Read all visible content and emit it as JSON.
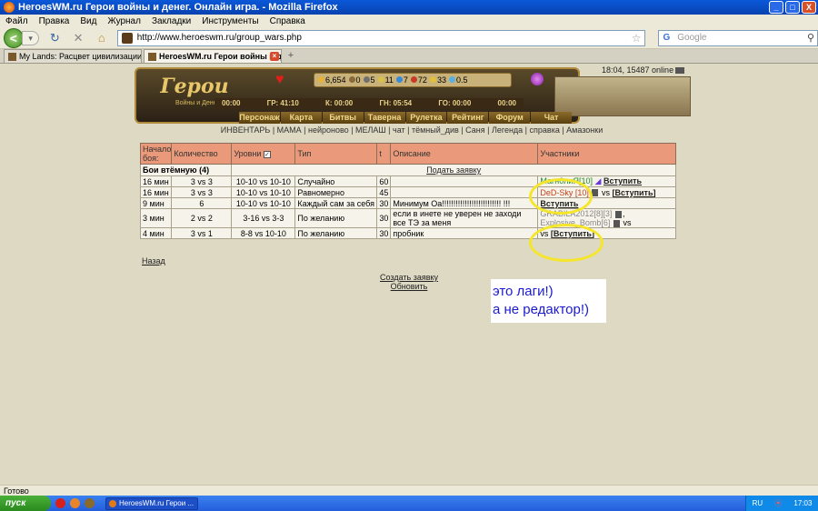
{
  "window": {
    "title": "HeroesWM.ru Герои войны и денег. Онлайн игра. - Mozilla Firefox",
    "min": "_",
    "max": "□",
    "close": "X"
  },
  "menu": [
    "Файл",
    "Правка",
    "Вид",
    "Журнал",
    "Закладки",
    "Инструменты",
    "Справка"
  ],
  "nav": {
    "back": "<",
    "forward": "▾",
    "url": "http://www.heroeswm.ru/group_wars.php",
    "search_engine": "G",
    "search_placeholder": "Google"
  },
  "tabs": [
    {
      "label": "My Lands: Расцвет цивилизации: Арх..."
    },
    {
      "label": "HeroesWM.ru Герои войны и ден..."
    }
  ],
  "game": {
    "logo": "Герои",
    "logo_sub": "Войны и Денег",
    "clock": "18:04, 15487 online",
    "resources": [
      "6,654",
      "0",
      "5",
      "11",
      "7",
      "72",
      "33",
      "0.5"
    ],
    "resource_colors": [
      "#e8b23a",
      "#8a6a3a",
      "#707070",
      "#d8c04a",
      "#3a8ad8",
      "#c83a2a",
      "#e0c03a",
      "#5ab0e0"
    ],
    "times": [
      "00:00",
      "ГР: 41:10",
      "К: 00:00",
      "ГН: 05:54",
      "ГО: 00:00",
      "00:00"
    ],
    "main_nav": [
      "Персонаж",
      "Карта",
      "Битвы",
      "Таверна",
      "Рулетка",
      "Рейтинг",
      "Форум",
      "Чат"
    ],
    "sub_nav": "ИНВЕНТАРЬ | МАМА | нейроново | МЕЛАШ | чат | тёмный_див | Саня | Легенда | справка | Амазонки"
  },
  "table": {
    "headers": [
      "Начало боя:",
      "Количество",
      "Уровни",
      "Тип",
      "t",
      "Описание",
      "Участники"
    ],
    "checkbox_mark": "✓",
    "group_title": "Бои втёмную (4)",
    "group_action": "Подать заявку",
    "rows": [
      {
        "start": "16 мин",
        "count": "3 vs 3",
        "levels": "10-10 vs 10-10",
        "type": "Случайно",
        "t": "60",
        "desc": "",
        "p_name": "Магн0лиЯ[10]",
        "p_vs": "",
        "p_name2": "",
        "join": "Вступить"
      },
      {
        "start": "16 мин",
        "count": "3 vs 3",
        "levels": "10-10 vs 10-10",
        "type": "Равномерно",
        "t": "45",
        "desc": "",
        "p_name": "DeD-Sky [10]",
        "p_vs": "vs",
        "p_name2": "",
        "join": "[Вступить]"
      },
      {
        "start": "9 мин",
        "count": "6",
        "levels": "10-10 vs 10-10",
        "type": "Каждый сам за себя",
        "t": "30",
        "desc": "Минимум Оа!!!!!!!!!!!!!!!!!!!!!!!!!! !!!",
        "p_name": "",
        "p_vs": "",
        "p_name2": "",
        "join": "Вступить"
      },
      {
        "start": "3 мин",
        "count": "2 vs 2",
        "levels": "3-16 vs 3-3",
        "type": "По желанию",
        "t": "30",
        "desc": "если в инете не уверен не заходи все ТЭ за меня",
        "p_name": "GRABILA2012[8][3]",
        "p_vs": "vs",
        "p_name2": "Explosive_Bomb[6]",
        "join": ""
      },
      {
        "start": "4 мин",
        "count": "3 vs 1",
        "levels": "8-8 vs 10-10",
        "type": "По желанию",
        "t": "30",
        "desc": "пробник",
        "p_name": "",
        "p_vs": "vs",
        "p_name2": "",
        "join": "[Вступить]"
      }
    ]
  },
  "links": {
    "back": "Назад",
    "create": "Создать заявку",
    "refresh": "Обновить"
  },
  "note": {
    "line1": "это лаги!)",
    "line2": "а не редактор!)"
  },
  "status": "Готово",
  "taskbar": {
    "start": "пуск",
    "task": "HeroesWM.ru Герои ...",
    "lang": "RU",
    "time": "17:03"
  }
}
